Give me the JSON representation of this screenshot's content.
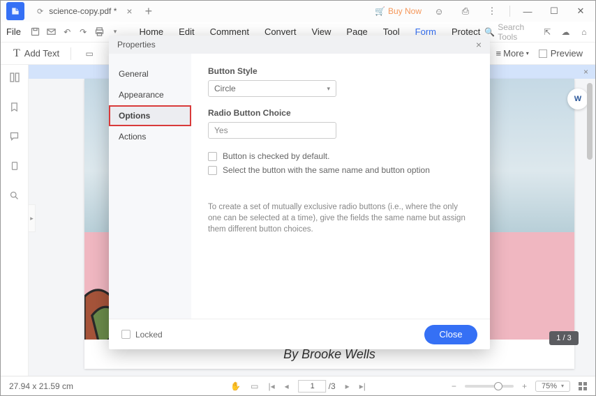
{
  "titlebar": {
    "tab_name": "science-copy.pdf *",
    "buy_now": "Buy Now"
  },
  "menubar": {
    "file": "File",
    "items": [
      "Home",
      "Edit",
      "Comment",
      "Convert",
      "View",
      "Page",
      "Tool",
      "Form",
      "Protect"
    ],
    "search_placeholder": "Search Tools"
  },
  "toolbar2": {
    "add_text": "Add Text",
    "more": "More",
    "preview": "Preview"
  },
  "dialog": {
    "title": "Properties",
    "nav": {
      "general": "General",
      "appearance": "Appearance",
      "options": "Options",
      "actions": "Actions"
    },
    "button_style_label": "Button Style",
    "button_style_value": "Circle",
    "radio_choice_label": "Radio Button Choice",
    "radio_choice_value": "Yes",
    "chk1": "Button is checked by default.",
    "chk2": "Select the button with the same name and button option",
    "hint": "To create a set of mutually exclusive radio buttons (i.e., where the only one can be selected at a time), give the fields the same name but assign them different button choices.",
    "locked": "Locked",
    "close": "Close"
  },
  "doc": {
    "byline": "By Brooke Wells",
    "page_badge": "1 / 3"
  },
  "statusbar": {
    "dims": "27.94 x 21.59 cm",
    "page_current": "1",
    "page_total": "/3",
    "zoom": "75%"
  }
}
